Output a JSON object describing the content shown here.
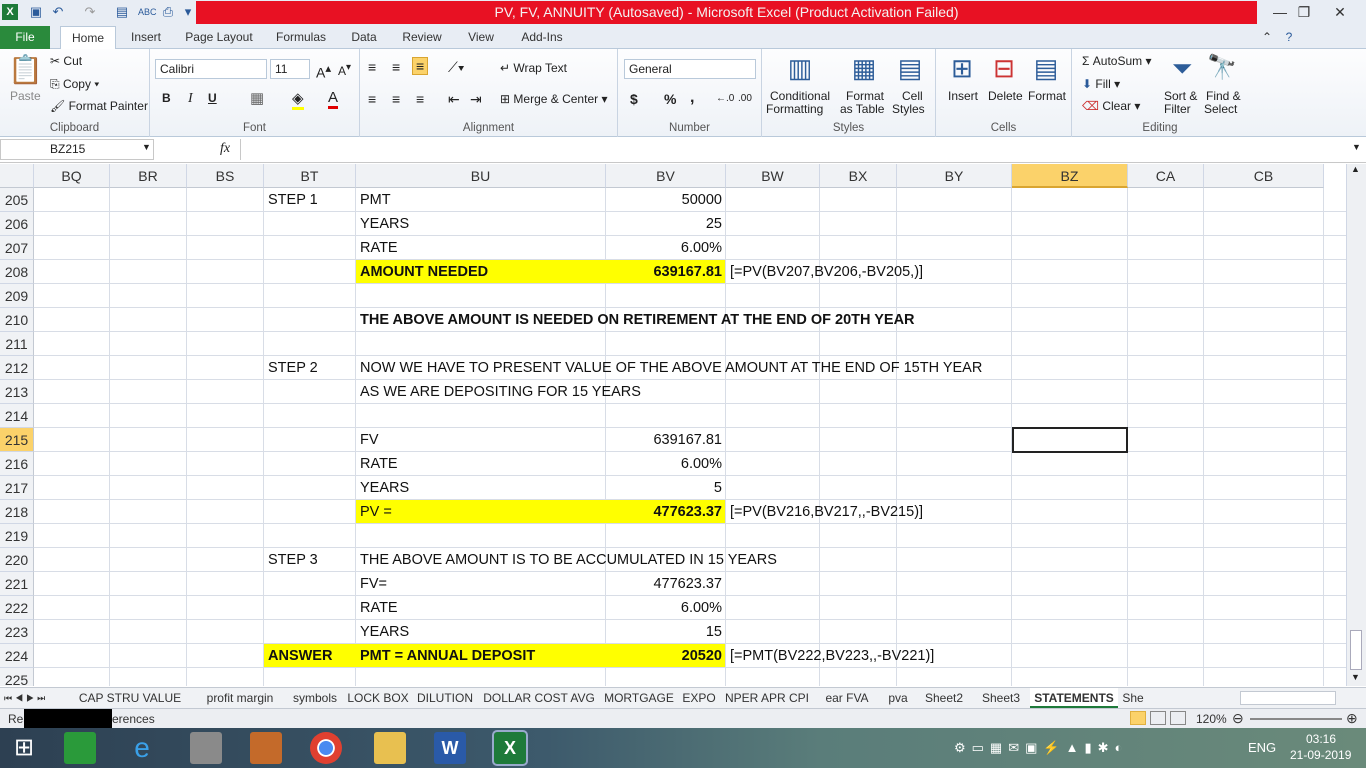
{
  "window": {
    "title": "PV, FV, ANNUITY (Autosaved)  -  Microsoft Excel (Product Activation Failed)",
    "title_bg": "#e81123"
  },
  "ribbon_tabs": [
    "File",
    "Home",
    "Insert",
    "Page Layout",
    "Formulas",
    "Data",
    "Review",
    "View",
    "Add-Ins"
  ],
  "ribbon": {
    "clipboard": {
      "paste": "Paste",
      "cut": "Cut",
      "copy": "Copy",
      "format_painter": "Format Painter",
      "label": "Clipboard"
    },
    "font": {
      "name": "Calibri",
      "size": "11",
      "bold": "B",
      "italic": "I",
      "underline": "U",
      "label": "Font"
    },
    "alignment": {
      "wrap": "Wrap Text",
      "merge": "Merge & Center",
      "label": "Alignment"
    },
    "number": {
      "format": "General",
      "currency": "$",
      "percent": "%",
      "comma": ",",
      "label": "Number"
    },
    "styles": {
      "conditional": "Conditional",
      "conditional2": "Formatting",
      "format_table": "Format",
      "format_table2": "as Table",
      "cell_styles": "Cell",
      "cell_styles2": "Styles",
      "label": "Styles"
    },
    "cells": {
      "insert": "Insert",
      "delete": "Delete",
      "format": "Format",
      "label": "Cells"
    },
    "editing": {
      "autosum": "AutoSum",
      "fill": "Fill",
      "clear": "Clear",
      "sort": "Sort &",
      "sort2": "Filter",
      "find": "Find &",
      "find2": "Select",
      "label": "Editing"
    }
  },
  "formula_bar": {
    "name_box": "BZ215",
    "fx": "fx",
    "formula": ""
  },
  "columns": [
    "BQ",
    "BR",
    "BS",
    "BT",
    "BU",
    "BV",
    "BW",
    "BX",
    "BY",
    "BZ",
    "CA",
    "CB"
  ],
  "rows": [
    "205",
    "206",
    "207",
    "208",
    "209",
    "210",
    "211",
    "212",
    "213",
    "214",
    "215",
    "216",
    "217",
    "218",
    "219",
    "220",
    "221",
    "222",
    "223",
    "224",
    "225"
  ],
  "cells": {
    "r205": {
      "bt": "STEP 1",
      "bu": "PMT",
      "bv": "50000"
    },
    "r206": {
      "bu": "YEARS",
      "bv": "25"
    },
    "r207": {
      "bu": "RATE",
      "bv": "6.00%"
    },
    "r208": {
      "bu": "AMOUNT NEEDED",
      "bv": "639167.81",
      "bw": "[=PV(BV207,BV206,-BV205,)]"
    },
    "r210": {
      "bu": "THE ABOVE AMOUNT IS NEEDED ON RETIREMENT AT THE END OF 20TH YEAR"
    },
    "r212": {
      "bt": "STEP 2",
      "bu": "NOW WE HAVE TO PRESENT VALUE OF THE ABOVE AMOUNT AT THE END OF 15TH YEAR"
    },
    "r213": {
      "bu": "AS WE ARE DEPOSITING FOR 15 YEARS"
    },
    "r215": {
      "bu": "FV",
      "bv": "639167.81"
    },
    "r216": {
      "bu": "RATE",
      "bv": "6.00%"
    },
    "r217": {
      "bu": "YEARS",
      "bv": "5"
    },
    "r218": {
      "bu": "PV =",
      "bv": "477623.37",
      "bw": "[=PV(BV216,BV217,,-BV215)]"
    },
    "r220": {
      "bt": "STEP 3",
      "bu": "THE ABOVE AMOUNT IS TO BE ACCUMULATED IN 15 YEARS"
    },
    "r221": {
      "bu": "FV=",
      "bv": "477623.37"
    },
    "r222": {
      "bu": "RATE",
      "bv": "6.00%"
    },
    "r223": {
      "bu": "YEARS",
      "bv": "15"
    },
    "r224": {
      "bt": "ANSWER",
      "bu": "PMT = ANNUAL DEPOSIT",
      "bv": "20520",
      "bw": "[=PMT(BV222,BV223,,-BV221)]"
    }
  },
  "highlight_color": "#ffff00",
  "selected_cell": "BZ215",
  "sheet_tabs": [
    "CAP STRU VALUE",
    "profit margin",
    "symbols",
    "LOCK BOX",
    "DILUTION",
    "DOLLAR COST AVG",
    "MORTGAGE",
    "EXPO",
    "NPER APR CPI",
    "ear FVA",
    "pva",
    "Sheet2",
    "Sheet3",
    "STATEMENTS",
    "She"
  ],
  "active_sheet": "STATEMENTS",
  "status": {
    "left": "Rea",
    "refs": "erences",
    "zoom": "120%"
  },
  "taskbar": {
    "lang": "ENG",
    "time": "03:16",
    "date": "21-09-2019"
  }
}
